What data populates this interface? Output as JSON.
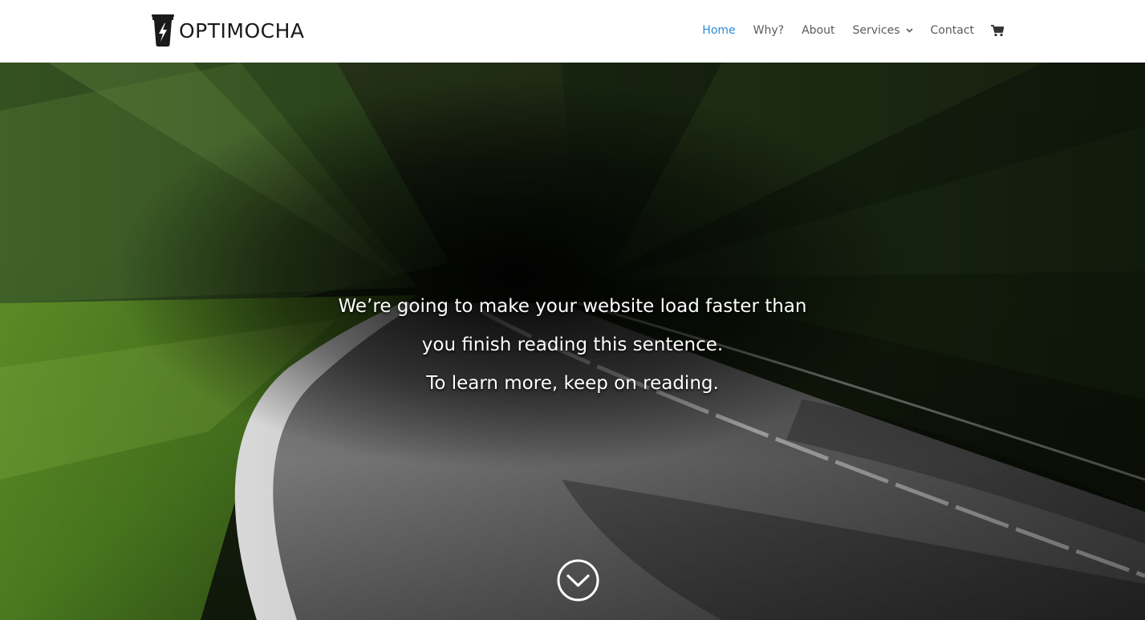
{
  "brand": {
    "name": "OPTIMOCHA",
    "logo_icon": "coffee-cup-lightning-icon"
  },
  "nav": {
    "items": [
      {
        "label": "Home",
        "active": true
      },
      {
        "label": "Why?",
        "active": false
      },
      {
        "label": "About",
        "active": false
      },
      {
        "label": "Services",
        "active": false,
        "has_dropdown": true
      },
      {
        "label": "Contact",
        "active": false
      }
    ],
    "cart_icon": "shopping-cart-icon"
  },
  "hero": {
    "line1": "We’re going to make your website load faster than",
    "line2": "you finish reading this sentence.",
    "line3": "To learn more, keep on reading.",
    "scroll_icon": "chevron-down-circle-icon"
  },
  "colors": {
    "accent": "#2e8bd8",
    "nav_text": "#595959",
    "header_bg": "#ffffff",
    "hero_text": "#ffffff"
  }
}
